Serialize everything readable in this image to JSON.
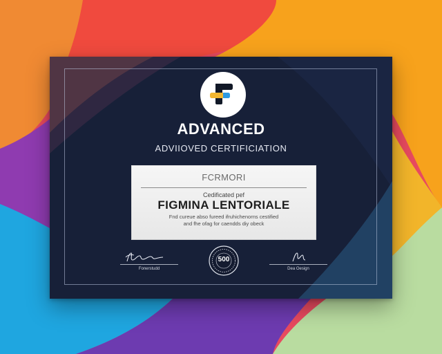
{
  "certificate": {
    "title": "ADVANCED",
    "subtitle": "ADVIIOVED CERTIFICIATION",
    "panel_heading": "FCRMORI",
    "panel_intro": "Cedificated pef",
    "recipient_name": "FIGMINA LENTORIALE",
    "body_line_1": "Fnd cureue abso fureed ifruhichenorns cestified",
    "body_line_2": "and fhe ofag for caendds diy obeck",
    "signature_left_label": "Fonerstudd",
    "signature_right_label": "Dea Oesign",
    "seal_text": "500"
  },
  "colors": {
    "certificate_navy": "#172038",
    "accent_yellow": "#f2b630",
    "accent_blue": "#2f9ae0",
    "logo_dark": "#111827"
  },
  "icons": {
    "logo": "f-letter-logo-icon",
    "seal": "round-seal-icon",
    "signature_left": "handwritten-signature",
    "signature_right": "handwritten-signature"
  }
}
